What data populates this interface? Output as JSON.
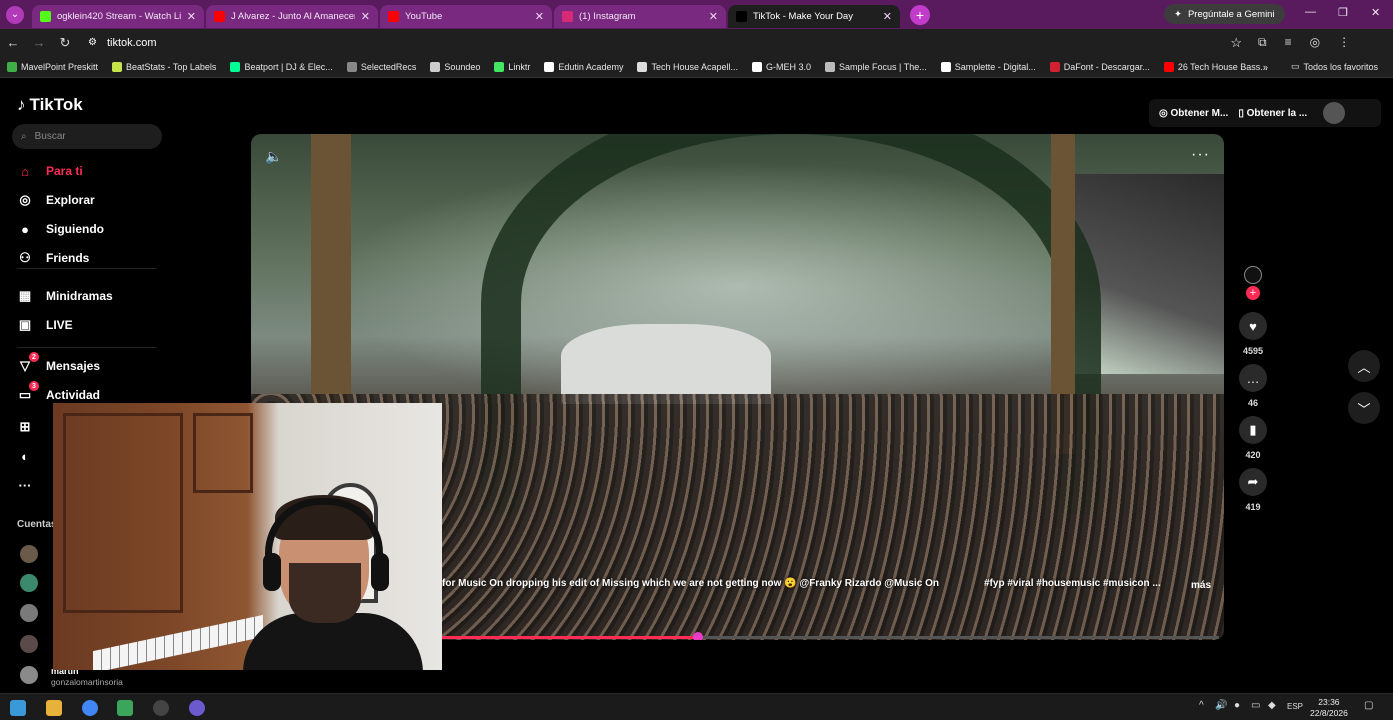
{
  "tabs": [
    {
      "title": "ogklein420 Stream - Watch Live",
      "color": "#53fc18",
      "active": false
    },
    {
      "title": "J Alvarez - Junto Al Amanecer (",
      "color": "#ff0000",
      "active": false
    },
    {
      "title": "YouTube",
      "color": "#ff0000",
      "active": false
    },
    {
      "title": "(1) Instagram",
      "color": "#d62976",
      "active": false
    },
    {
      "title": "TikTok - Make Your Day",
      "color": "#000000",
      "active": true
    }
  ],
  "gemini": "Pregúntale a Gemini",
  "address": "tiktok.com",
  "bookmarks": [
    {
      "label": "MavelPoint Preskitt",
      "color": "#3fae49"
    },
    {
      "label": "BeatStats - Top Labels",
      "color": "#c7e34a"
    },
    {
      "label": "Beatport | DJ & Elec...",
      "color": "#01ff95"
    },
    {
      "label": "SelectedRecs",
      "color": "#888888"
    },
    {
      "label": "Soundeo",
      "color": "#cccccc"
    },
    {
      "label": "Linktr",
      "color": "#43e660"
    },
    {
      "label": "Edutin Academy",
      "color": "#ffffff"
    },
    {
      "label": "Tech House Acapell...",
      "color": "#dddddd"
    },
    {
      "label": "G-MEH 3.0",
      "color": "#ffffff"
    },
    {
      "label": "Sample Focus | The...",
      "color": "#bbbbbb"
    },
    {
      "label": "Samplette - Digital...",
      "color": "#ffffff"
    },
    {
      "label": "DaFont - Descargar...",
      "color": "#d1202f"
    },
    {
      "label": "26 Tech House Bass...",
      "color": "#ff0000"
    }
  ],
  "bookmarks_all": "Todos los favoritos",
  "sidebar": {
    "logo": "TikTok",
    "search_placeholder": "Buscar",
    "items": [
      {
        "label": "Para ti",
        "icon": "home-icon",
        "active": true
      },
      {
        "label": "Explorar",
        "icon": "compass-icon"
      },
      {
        "label": "Siguiendo",
        "icon": "following-avatar-icon"
      },
      {
        "label": "Friends",
        "icon": "friends-icon"
      },
      {
        "label": "Minidramas",
        "icon": "film-icon"
      },
      {
        "label": "LIVE",
        "icon": "live-icon"
      },
      {
        "label": "Mensajes",
        "icon": "send-icon",
        "badge": "2"
      },
      {
        "label": "Actividad",
        "icon": "inbox-icon",
        "badge": "3"
      }
    ],
    "accounts_title": "Cuentas",
    "last_account_name": "martin",
    "last_account_handle": "gonzalomartinsoria"
  },
  "top_buttons": {
    "get_coins": "Obtener M...",
    "get_app": "Obtener la ..."
  },
  "video": {
    "caption": "for Music On dropping his edit of Missing which we are not getting now 😮 @Franky Rizardo @Music On",
    "hashtags": "#fyp #viral #housemusic #musicon ...",
    "more": "más",
    "progress": 0.33
  },
  "actions": {
    "likes": "4595",
    "comments": "46",
    "saves": "420",
    "shares": "419"
  },
  "taskbar": {
    "lang": "ESP",
    "time": "23:36",
    "date": "22/8/2026"
  }
}
